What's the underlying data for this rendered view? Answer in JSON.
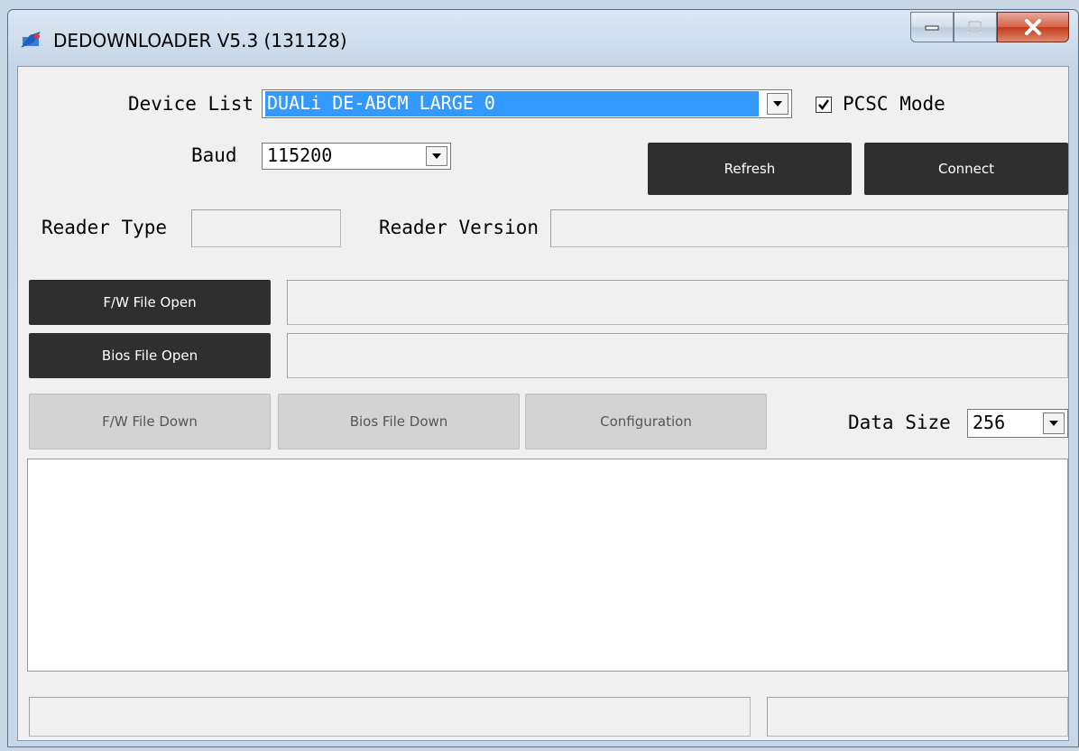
{
  "window": {
    "title": "DEDOWNLOADER V5.3 (131128)"
  },
  "device": {
    "label": "Device List",
    "value": "DUALi DE-ABCM LARGE 0"
  },
  "pcsc": {
    "label": "PCSC Mode",
    "checked": true
  },
  "baud": {
    "label": "Baud",
    "value": "115200"
  },
  "buttons": {
    "refresh": "Refresh",
    "connect": "Connect",
    "fw_open": "F/W File Open",
    "bios_open": "Bios File Open",
    "fw_down": "F/W File Down",
    "bios_down": "Bios File Down",
    "configuration": "Configuration"
  },
  "reader": {
    "type_label": "Reader Type",
    "version_label": "Reader Version",
    "type_value": "",
    "version_value": ""
  },
  "data_size": {
    "label": "Data Size",
    "value": "256"
  },
  "icons": {
    "app": "app-icon",
    "minimize": "minimize-icon",
    "maximize": "maximize-icon",
    "close": "close-icon"
  }
}
